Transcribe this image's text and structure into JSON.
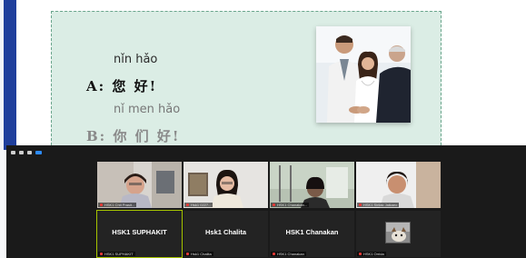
{
  "slide": {
    "line1_pinyin": "nǐn hǎo",
    "line1_speaker": "A:",
    "line1_chars": "您 好!",
    "line2_pinyin": "nǐ men hǎo",
    "line2_speaker": "B:",
    "line2_chars": "你 们 好!"
  },
  "zoom": {
    "participants": [
      {
        "big_name": "",
        "label": "HSK1 Chit Prasit..."
      },
      {
        "big_name": "",
        "label": "Hsk1 0227..."
      },
      {
        "big_name": "",
        "label": "HSK1 Chanakan..."
      },
      {
        "big_name": "",
        "label": "HSK1 Sirilak Jaikaeo"
      },
      {
        "big_name": "HSK1 SUPHAKIT",
        "label": "HSK1 SUPHAKIT"
      },
      {
        "big_name": "Hsk1 Chalita",
        "label": "Hsk1 Chalita"
      },
      {
        "big_name": "HSK1 Chanakan",
        "label": "HSK1 Chanakan"
      },
      {
        "big_name": "",
        "label": "HSK1 Orrida"
      }
    ]
  },
  "colors": {
    "slide_card": "#dbede5",
    "left_bar": "#1f3f9c",
    "active_speaker": "#a6c400",
    "mic_muted": "#e53935"
  }
}
